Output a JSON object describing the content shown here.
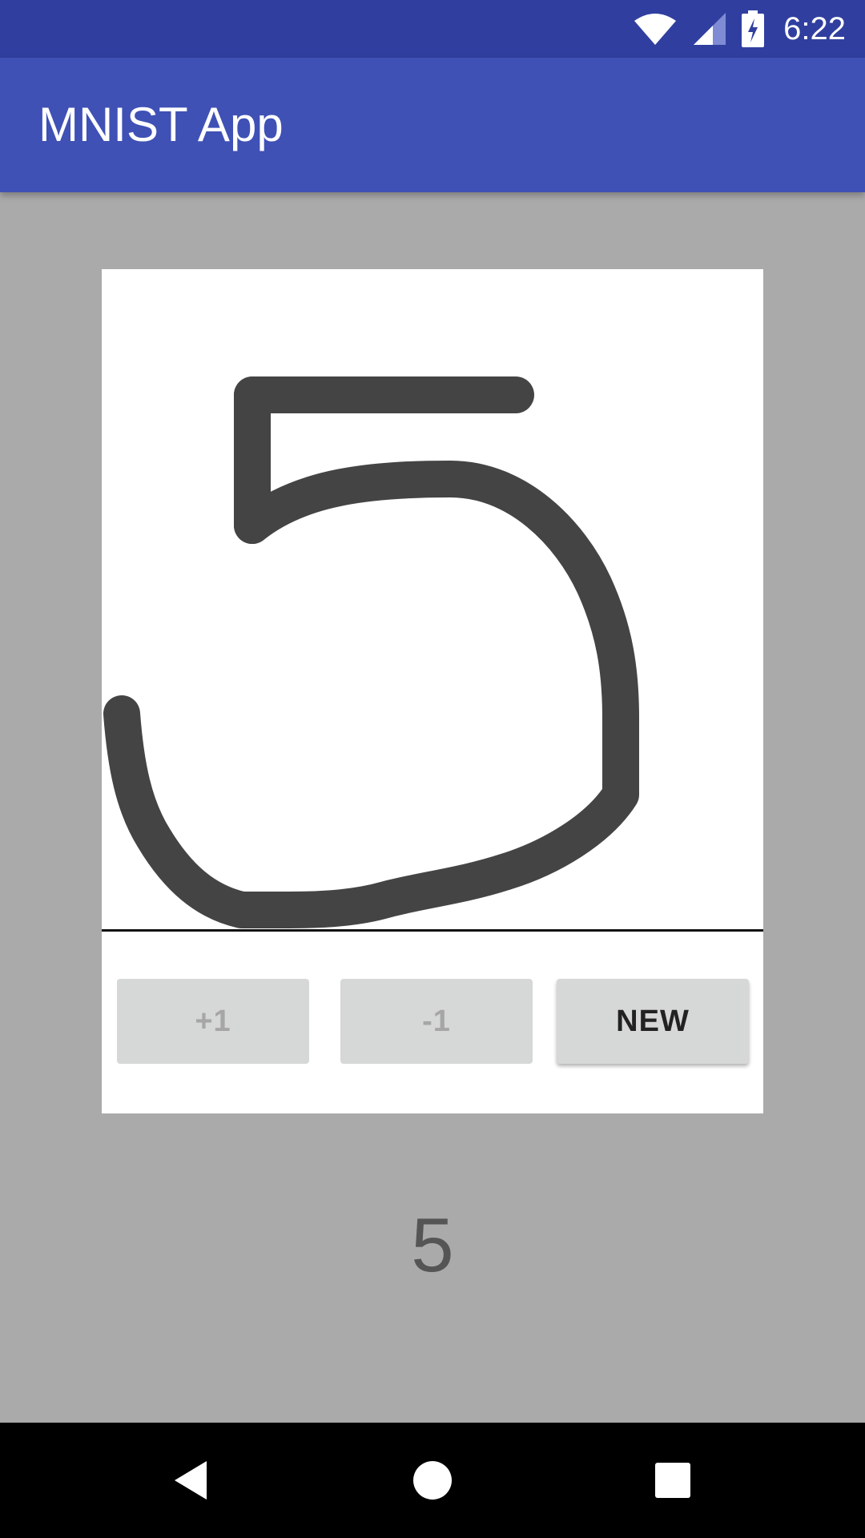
{
  "status_bar": {
    "time": "6:22",
    "icons": [
      "wifi-icon",
      "cell-signal-icon",
      "battery-charging-icon"
    ]
  },
  "app_bar": {
    "title": "MNIST App"
  },
  "canvas": {
    "stroke_color": "#444444",
    "drawn_digit": "5"
  },
  "buttons": {
    "plus_label": "+1",
    "minus_label": "-1",
    "new_label": "NEW"
  },
  "result": {
    "prediction": "5"
  },
  "nav_bar": {
    "icons": [
      "back-icon",
      "home-icon",
      "recents-icon"
    ]
  },
  "colors": {
    "status_bar": "#303f9f",
    "app_bar": "#3f51b5",
    "background": "#aaaaaa",
    "button": "#d6d7d7"
  }
}
